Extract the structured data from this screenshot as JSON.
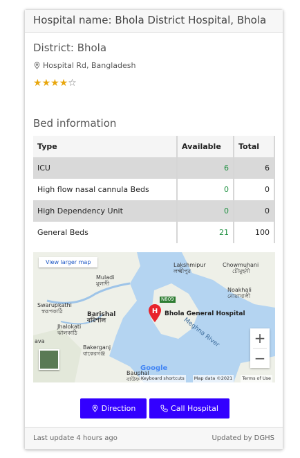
{
  "hospital_title": "Hospital name: Bhola District Hospital, Bhola",
  "district": "District: Bhola",
  "address": "Hospital Rd, Bangladesh",
  "rating": {
    "value": 4,
    "max": 5,
    "icon": "star-icon"
  },
  "bed_section_title": "Bed information",
  "bed_table": {
    "headers": [
      "Type",
      "Available",
      "Total"
    ],
    "rows": [
      {
        "type": "ICU",
        "available": "6",
        "total": "6"
      },
      {
        "type": "High flow nasal cannula Beds",
        "available": "0",
        "total": "0"
      },
      {
        "type": "High Dependency Unit",
        "available": "0",
        "total": "0"
      },
      {
        "type": "General Beds",
        "available": "21",
        "total": "100"
      }
    ]
  },
  "map": {
    "view_larger": "View larger map",
    "pin_label": "Bhola General Hospital",
    "places": {
      "lakshmipur": "Lakshmipur",
      "lakshmipur_bn": "লক্ষ্মীপুর",
      "chowmuhani": "Chowmuhani",
      "chowmuhani_bn": "চৌমুহনী",
      "muladi": "Muladi",
      "muladi_bn": "মুলাদী",
      "noakhali": "Noakhali",
      "noakhali_bn": "নোয়াখালী",
      "swarupkathi": "Swarupkathi",
      "swarupkathi_bn": "স্বরূপকাঠি",
      "barishal": "Barishal",
      "barishal_bn": "বরিশাল",
      "jhalokati": "Jhalokati",
      "jhalokati_bn": "ঝালকাঠি",
      "bakerganj": "Bakerganj",
      "bakerganj_bn": "বাকেরগঞ্জ",
      "bauphal": "Bauphal",
      "bauphal_bn": "বাউফল",
      "meghna_river": "Meghna River",
      "road_n809": "N809",
      "ava": "ava"
    },
    "zoom_in": "+",
    "zoom_out": "−",
    "google_logo": "Google",
    "footer": {
      "shortcuts": "Keyboard shortcuts",
      "map_data": "Map data ©2021",
      "terms": "Terms of Use"
    },
    "colors": {
      "water": "#b4d4f1",
      "land": "#eef0e8",
      "pin": "#e8232b"
    }
  },
  "buttons": {
    "direction": "Direction",
    "call": "Call Hospital"
  },
  "accent_color": "#3300ff",
  "footer": {
    "last_update": "Last update 4 hours ago",
    "updated_by": "Updated by DGHS"
  }
}
